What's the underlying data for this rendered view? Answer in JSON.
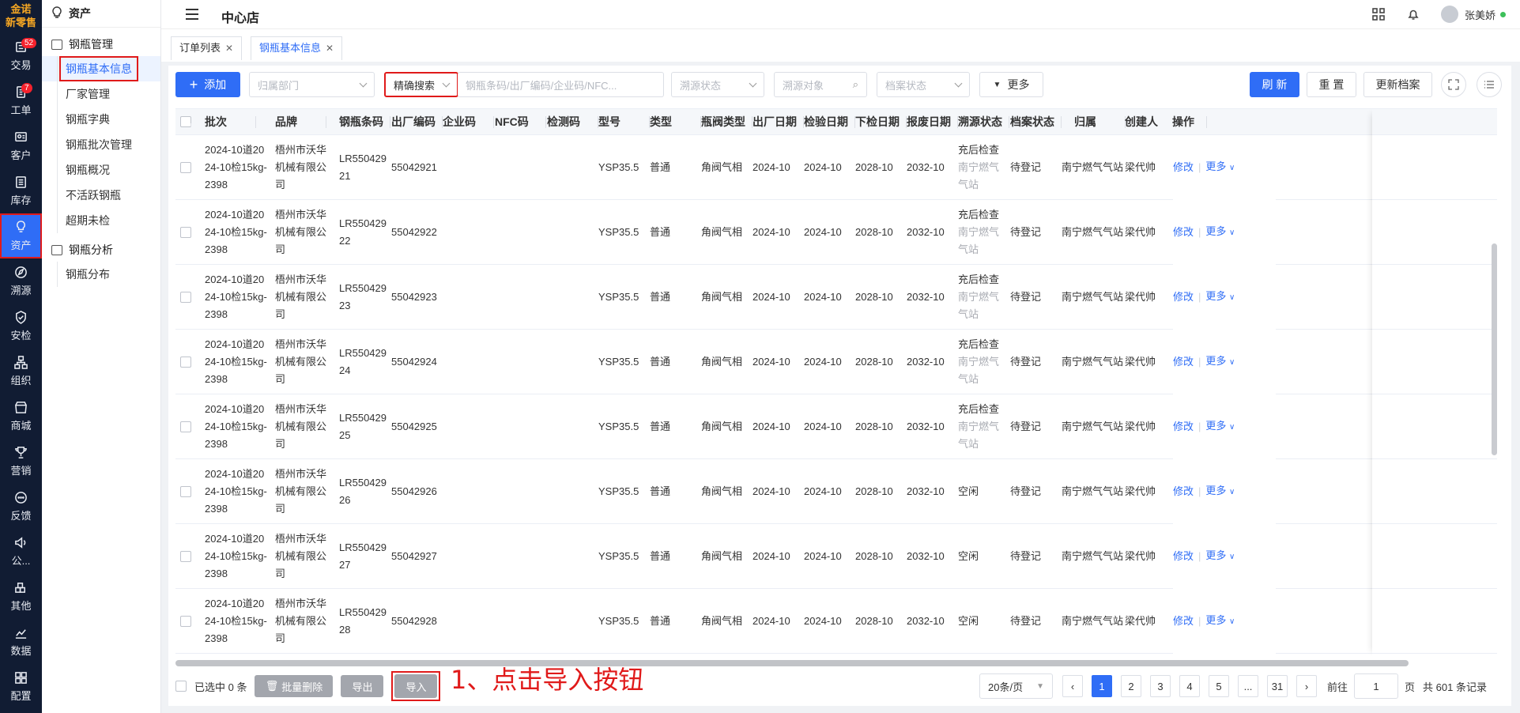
{
  "rail": {
    "logo_line1": "金诺",
    "logo_line2": "新零售",
    "items": [
      {
        "label": "交易",
        "badge": "52"
      },
      {
        "label": "工单",
        "badge": "7"
      },
      {
        "label": "客户"
      },
      {
        "label": "库存"
      },
      {
        "label": "资产"
      },
      {
        "label": "溯源"
      },
      {
        "label": "安检"
      },
      {
        "label": "组织"
      },
      {
        "label": "商城"
      },
      {
        "label": "营销"
      },
      {
        "label": "反馈"
      },
      {
        "label": "公..."
      },
      {
        "label": "其他"
      },
      {
        "label": "数据"
      },
      {
        "label": "配置"
      }
    ]
  },
  "sidebar": {
    "header": "资产",
    "group1": "钢瓶管理",
    "group1_items": [
      "钢瓶基本信息",
      "厂家管理",
      "钢瓶字典",
      "钢瓶批次管理",
      "钢瓶概况",
      "不活跃钢瓶",
      "超期未检"
    ],
    "group2": "钢瓶分析",
    "group2_items": [
      "钢瓶分布"
    ]
  },
  "topbar": {
    "store": "中心店",
    "user": "张美娇"
  },
  "tabs": [
    {
      "label": "订单列表"
    },
    {
      "label": "钢瓶基本信息"
    }
  ],
  "toolbar": {
    "add": "添加",
    "dept_placeholder": "归属部门",
    "search_mode": "精确搜索",
    "search_placeholder": "钢瓶条码/出厂编码/企业码/NFC...",
    "trace_status_placeholder": "溯源状态",
    "trace_target_placeholder": "溯源对象",
    "archive_status_placeholder": "档案状态",
    "more": "更多",
    "refresh": "刷 新",
    "reset": "重 置",
    "update_archive": "更新档案"
  },
  "table": {
    "columns": [
      "批次",
      "品牌",
      "钢瓶条码",
      "出厂编码",
      "企业码",
      "NFC码",
      "检测码",
      "型号",
      "类型",
      "瓶阀类型",
      "出厂日期",
      "检验日期",
      "下检日期",
      "报废日期",
      "溯源状态",
      "档案状态",
      "归属",
      "创建人",
      "操作"
    ],
    "rows": [
      {
        "batch": "2024-10道2024-10检15kg-2398",
        "brand": "梧州市沃华机械有限公司",
        "barcode": "LR55042921",
        "factory": "55042921",
        "company": "",
        "nfc": "",
        "test": "",
        "model": "YSP35.5",
        "type": "普通",
        "valve": "角阀气相",
        "out": "2024-10",
        "check": "2024-10",
        "next": "2028-10",
        "scrap": "2032-10",
        "trace1": "充后检查",
        "trace2": "南宁燃气气站",
        "archive": "待登记",
        "owner": "南宁燃气气站",
        "creator": "梁代帅"
      },
      {
        "batch": "2024-10道2024-10检15kg-2398",
        "brand": "梧州市沃华机械有限公司",
        "barcode": "LR55042922",
        "factory": "55042922",
        "company": "",
        "nfc": "",
        "test": "",
        "model": "YSP35.5",
        "type": "普通",
        "valve": "角阀气相",
        "out": "2024-10",
        "check": "2024-10",
        "next": "2028-10",
        "scrap": "2032-10",
        "trace1": "充后检查",
        "trace2": "南宁燃气气站",
        "archive": "待登记",
        "owner": "南宁燃气气站",
        "creator": "梁代帅"
      },
      {
        "batch": "2024-10道2024-10检15kg-2398",
        "brand": "梧州市沃华机械有限公司",
        "barcode": "LR55042923",
        "factory": "55042923",
        "company": "",
        "nfc": "",
        "test": "",
        "model": "YSP35.5",
        "type": "普通",
        "valve": "角阀气相",
        "out": "2024-10",
        "check": "2024-10",
        "next": "2028-10",
        "scrap": "2032-10",
        "trace1": "充后检查",
        "trace2": "南宁燃气气站",
        "archive": "待登记",
        "owner": "南宁燃气气站",
        "creator": "梁代帅"
      },
      {
        "batch": "2024-10道2024-10检15kg-2398",
        "brand": "梧州市沃华机械有限公司",
        "barcode": "LR55042924",
        "factory": "55042924",
        "company": "",
        "nfc": "",
        "test": "",
        "model": "YSP35.5",
        "type": "普通",
        "valve": "角阀气相",
        "out": "2024-10",
        "check": "2024-10",
        "next": "2028-10",
        "scrap": "2032-10",
        "trace1": "充后检查",
        "trace2": "南宁燃气气站",
        "archive": "待登记",
        "owner": "南宁燃气气站",
        "creator": "梁代帅"
      },
      {
        "batch": "2024-10道2024-10检15kg-2398",
        "brand": "梧州市沃华机械有限公司",
        "barcode": "LR55042925",
        "factory": "55042925",
        "company": "",
        "nfc": "",
        "test": "",
        "model": "YSP35.5",
        "type": "普通",
        "valve": "角阀气相",
        "out": "2024-10",
        "check": "2024-10",
        "next": "2028-10",
        "scrap": "2032-10",
        "trace1": "充后检查",
        "trace2": "南宁燃气气站",
        "archive": "待登记",
        "owner": "南宁燃气气站",
        "creator": "梁代帅"
      },
      {
        "batch": "2024-10道2024-10检15kg-2398",
        "brand": "梧州市沃华机械有限公司",
        "barcode": "LR55042926",
        "factory": "55042926",
        "company": "",
        "nfc": "",
        "test": "",
        "model": "YSP35.5",
        "type": "普通",
        "valve": "角阀气相",
        "out": "2024-10",
        "check": "2024-10",
        "next": "2028-10",
        "scrap": "2032-10",
        "trace1": "空闲",
        "trace2": "",
        "archive": "待登记",
        "owner": "南宁燃气气站",
        "creator": "梁代帅"
      },
      {
        "batch": "2024-10道2024-10检15kg-2398",
        "brand": "梧州市沃华机械有限公司",
        "barcode": "LR55042927",
        "factory": "55042927",
        "company": "",
        "nfc": "",
        "test": "",
        "model": "YSP35.5",
        "type": "普通",
        "valve": "角阀气相",
        "out": "2024-10",
        "check": "2024-10",
        "next": "2028-10",
        "scrap": "2032-10",
        "trace1": "空闲",
        "trace2": "",
        "archive": "待登记",
        "owner": "南宁燃气气站",
        "creator": "梁代帅"
      },
      {
        "batch": "2024-10道2024-10检15kg-2398",
        "brand": "梧州市沃华机械有限公司",
        "barcode": "LR55042928",
        "factory": "55042928",
        "company": "",
        "nfc": "",
        "test": "",
        "model": "YSP35.5",
        "type": "普通",
        "valve": "角阀气相",
        "out": "2024-10",
        "check": "2024-10",
        "next": "2028-10",
        "scrap": "2032-10",
        "trace1": "空闲",
        "trace2": "",
        "archive": "待登记",
        "owner": "南宁燃气气站",
        "creator": "梁代帅"
      }
    ],
    "edit": "修改",
    "more": "更多"
  },
  "footer": {
    "selected": "已选中 0 条",
    "batch_delete": "批量删除",
    "export": "导出",
    "import": "导入",
    "page_size": "20条/页",
    "pages": [
      "1",
      "2",
      "3",
      "4",
      "5",
      "...",
      "31"
    ],
    "goto": "前往",
    "goto_value": "1",
    "page_unit": "页",
    "total": "共 601 条记录"
  },
  "annotation": "1、点击导入按钮",
  "colors": {
    "primary": "#2f6df6",
    "rail": "#111c33",
    "highlight": "#e01a1a"
  }
}
